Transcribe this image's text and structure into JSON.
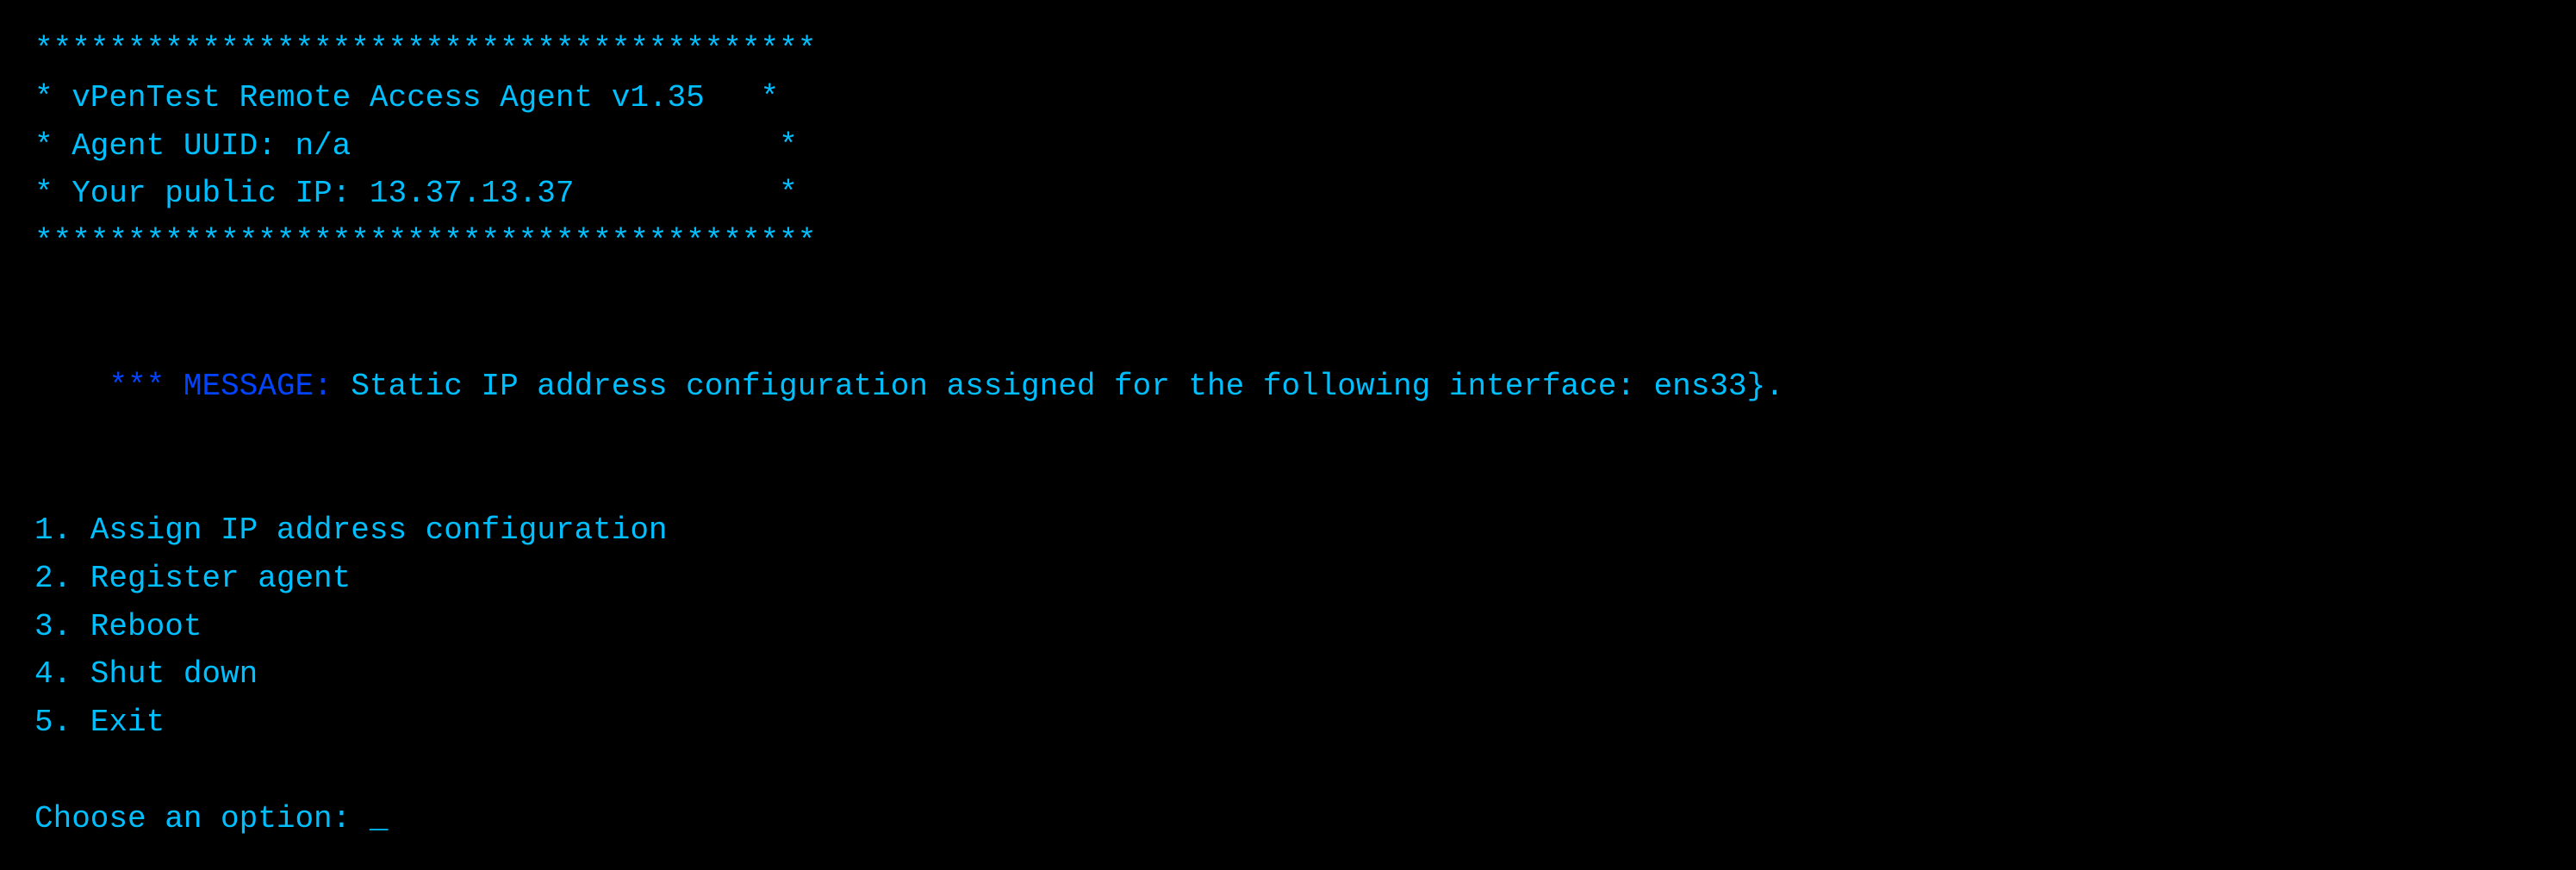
{
  "terminal": {
    "border_top": "******************************************",
    "title_line": "* vPenTest Remote Access Agent v1.35   *",
    "uuid_line": "* Agent UUID: n/a                       *",
    "ip_line": "* Your public IP: 13.37.13.37           *",
    "border_bot": "******************************************",
    "message_label": "*** MESSAGE:",
    "message_text": " Static IP address configuration assigned for the following interface: ens33}.",
    "menu": {
      "item1": "1. Assign IP address configuration",
      "item2": "2. Register agent",
      "item3": "3. Reboot",
      "item4": "4. Shut down",
      "item5": "5. Exit"
    },
    "prompt": "Choose an option: _"
  }
}
